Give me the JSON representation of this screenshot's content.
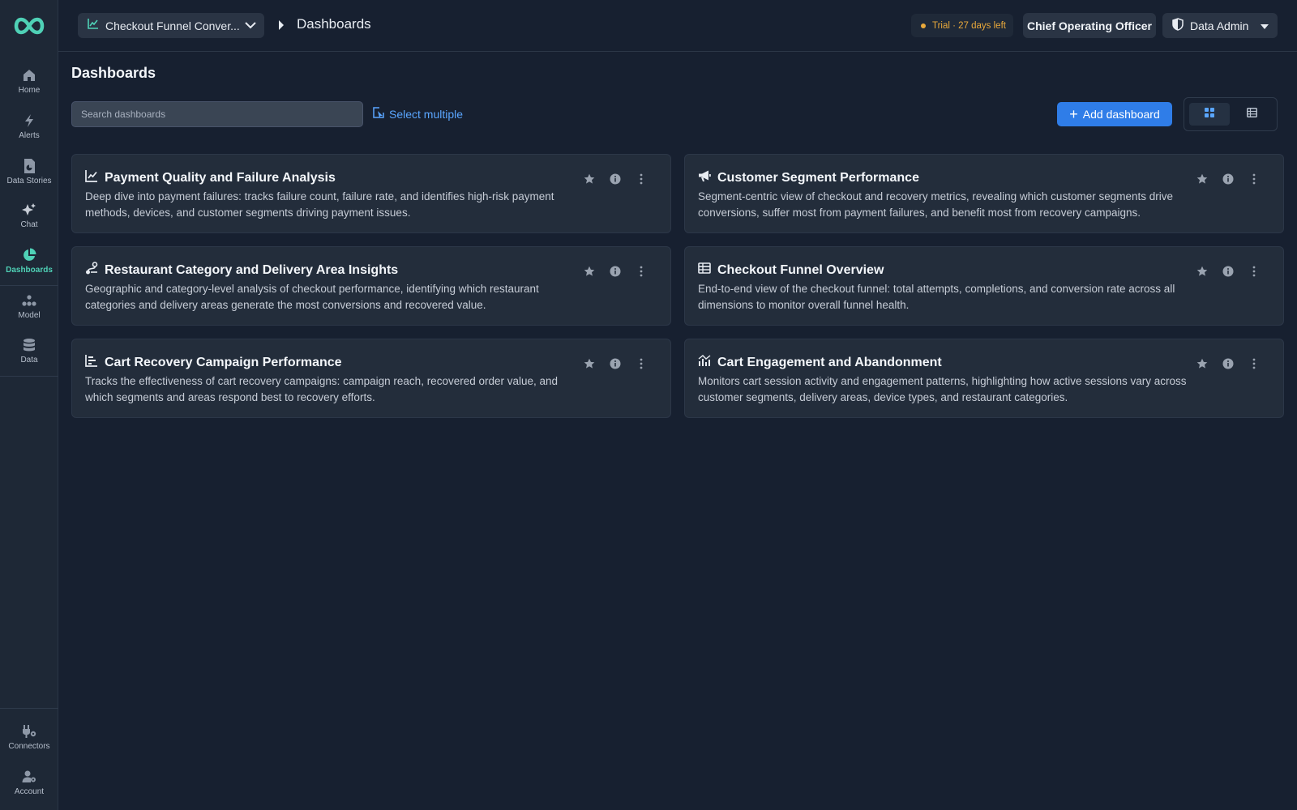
{
  "app": {
    "project_selector": "Checkout Funnel Conver...",
    "breadcrumb": "Dashboards",
    "trial_badge": "Trial · 27 days left",
    "role": "Chief Operating Officer",
    "user_menu": "Data Admin"
  },
  "sidebar": {
    "items": [
      {
        "label": "Home",
        "icon": "home-icon"
      },
      {
        "label": "Alerts",
        "icon": "bolt-icon"
      },
      {
        "label": "Data Stories",
        "icon": "data-story-icon"
      },
      {
        "label": "Chat",
        "icon": "sparkle-icon"
      },
      {
        "label": "Dashboards",
        "icon": "pie-chart-icon",
        "active": true
      },
      {
        "label": "Model",
        "icon": "model-icon"
      },
      {
        "label": "Data",
        "icon": "database-icon"
      }
    ],
    "bottom_items": [
      {
        "label": "Connectors",
        "icon": "plug-icon"
      },
      {
        "label": "Account",
        "icon": "account-settings-icon"
      }
    ]
  },
  "main": {
    "title": "Dashboards",
    "search_placeholder": "Search dashboards",
    "select_multiple": "Select multiple",
    "add_dashboard": "Add dashboard",
    "view_mode": "grid"
  },
  "dashboards": [
    {
      "title": "Payment Quality and Failure Analysis",
      "description": "Deep dive into payment failures: tracks failure count, failure rate, and identifies high-risk payment methods, devices, and customer segments driving payment issues.",
      "icon": "line-chart-icon"
    },
    {
      "title": "Customer Segment Performance",
      "description": "Segment-centric view of checkout and recovery metrics, revealing which customer segments drive conversions, suffer most from payment failures, and benefit most from recovery campaigns.",
      "icon": "megaphone-icon"
    },
    {
      "title": "Restaurant Category and Delivery Area Insights",
      "description": "Geographic and category-level analysis of checkout performance, identifying which restaurant categories and delivery areas generate the most conversions and recovered value.",
      "icon": "route-icon"
    },
    {
      "title": "Checkout Funnel Overview",
      "description": "End-to-end view of the checkout funnel: total attempts, completions, and conversion rate across all dimensions to monitor overall funnel health.",
      "icon": "table-icon"
    },
    {
      "title": "Cart Recovery Campaign Performance",
      "description": "Tracks the effectiveness of cart recovery campaigns: campaign reach, recovered order value, and which segments and areas respond best to recovery efforts.",
      "icon": "bar-chart-icon"
    },
    {
      "title": "Cart Engagement and Abandonment",
      "description": "Monitors cart session activity and engagement patterns, highlighting how active sessions vary across customer segments, delivery areas, device types, and restaurant categories.",
      "icon": "trend-bars-icon"
    }
  ],
  "colors": {
    "background": "#172030",
    "sidebar": "#1e2836",
    "card": "#232d3b",
    "accent_teal": "#4fd1b6",
    "accent_blue": "#2f7de8",
    "trial_orange": "#e9a93b"
  }
}
